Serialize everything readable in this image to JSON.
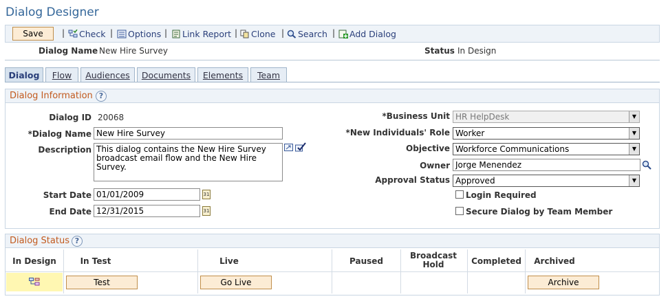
{
  "page": {
    "title": "Dialog Designer"
  },
  "toolbar": {
    "save_label": "Save",
    "links": [
      {
        "label": "Check",
        "icon": "check-icon"
      },
      {
        "label": "Options",
        "icon": "options-icon"
      },
      {
        "label": "Link Report",
        "icon": "link-report-icon"
      },
      {
        "label": "Clone",
        "icon": "clone-icon"
      },
      {
        "label": "Search",
        "icon": "search-icon"
      },
      {
        "label": "Add Dialog",
        "icon": "add-dialog-icon"
      }
    ],
    "separator": "|"
  },
  "header": {
    "dialog_name_label": "Dialog Name",
    "dialog_name_value": "New Hire Survey",
    "status_label": "Status",
    "status_value": "In Design"
  },
  "tabs": [
    {
      "label": "Dialog",
      "active": true
    },
    {
      "label": "Flow",
      "active": false
    },
    {
      "label": "Audiences",
      "active": false
    },
    {
      "label": "Documents",
      "active": false
    },
    {
      "label": "Elements",
      "active": false
    },
    {
      "label": "Team",
      "active": false
    }
  ],
  "dialog_info": {
    "title": "Dialog Information",
    "help": "?",
    "dialog_id_label": "Dialog ID",
    "dialog_id_value": "20068",
    "dialog_name_label": "*Dialog Name",
    "dialog_name_value": "New Hire Survey",
    "description_label": "Description",
    "description_value": "This dialog contains the New Hire Survey broadcast email flow and the New Hire Survey.",
    "start_date_label": "Start Date",
    "start_date_value": "01/01/2009",
    "end_date_label": "End Date",
    "end_date_value": "12/31/2015",
    "business_unit_label": "*Business Unit",
    "business_unit_value": "HR HelpDesk",
    "new_individuals_role_label": "*New Individuals' Role",
    "new_individuals_role_value": "Worker",
    "objective_label": "Objective",
    "objective_value": "Workforce Communications",
    "owner_label": "Owner",
    "owner_value": "Jorge Menendez",
    "approval_status_label": "Approval Status",
    "approval_status_value": "Approved",
    "login_required_label": "Login Required",
    "login_required_checked": false,
    "secure_dialog_label": "Secure Dialog by Team Member",
    "secure_dialog_checked": false
  },
  "dialog_status": {
    "title": "Dialog Status",
    "help": "?",
    "columns": [
      "In Design",
      "In Test",
      "Live",
      "Paused",
      "Broadcast Hold",
      "Completed",
      "Archived"
    ],
    "test_button": "Test",
    "go_live_button": "Go Live",
    "archive_button": "Archive",
    "current_icon": "in-design-flow-icon"
  },
  "colors": {
    "title_blue": "#336699",
    "section_orange": "#c25a1e",
    "button_bg": "#fcecd5",
    "highlight_yellow": "#fff7b2"
  }
}
